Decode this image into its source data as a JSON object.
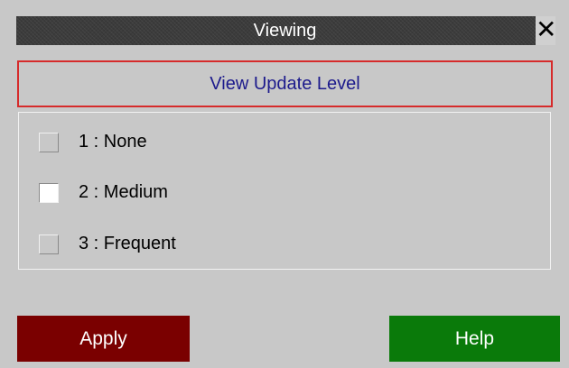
{
  "window": {
    "title": "Viewing",
    "close_symbol": "✕"
  },
  "header": {
    "label": "View Update Level"
  },
  "options": [
    {
      "label": "1 : None",
      "selected": false
    },
    {
      "label": "2 : Medium",
      "selected": true
    },
    {
      "label": "3 : Frequent",
      "selected": false
    }
  ],
  "buttons": {
    "apply": "Apply",
    "help": "Help"
  },
  "colors": {
    "background": "#c8c8c8",
    "titlebar": "#3c3c3c",
    "header_border": "#d62b2b",
    "header_text": "#1c1a8c",
    "apply": "#7a0000",
    "help": "#0a7a0a"
  },
  "icons": {
    "close": "close-icon"
  }
}
